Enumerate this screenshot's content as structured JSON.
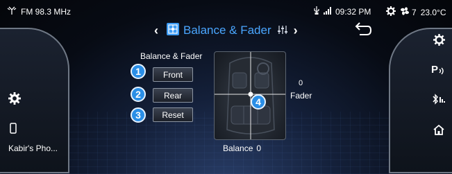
{
  "status_bar": {
    "source": "FM 98.3 MHz",
    "time": "09:32 PM",
    "fan_level": "7",
    "temperature": "23.0°C"
  },
  "header": {
    "title": "Balance & Fader"
  },
  "panel": {
    "label": "Balance & Fader",
    "buttons": [
      {
        "badge": "1",
        "label": "Front"
      },
      {
        "badge": "2",
        "label": "Rear"
      },
      {
        "badge": "3",
        "label": "Reset"
      }
    ],
    "marker_badge": "4",
    "fader_value": "0",
    "fader_label": "Fader",
    "balance_label": "Balance",
    "balance_value": "0"
  },
  "sidebar_left": {
    "phone_label": "Kabir's Pho..."
  },
  "icons": {
    "signal": "antenna-icon",
    "usb": "usb-icon",
    "cellular": "signal-bars-icon",
    "settings": "gear-icon",
    "fan": "fan-icon",
    "phone": "phone-icon",
    "parking": "parking-sensor-icon",
    "bluetooth": "bluetooth-icon",
    "home": "home-icon",
    "back": "back-arrow-icon",
    "equalizer": "equalizer-icon"
  },
  "colors": {
    "accent": "#4aa6ff",
    "badge": "#2a8ee6"
  }
}
